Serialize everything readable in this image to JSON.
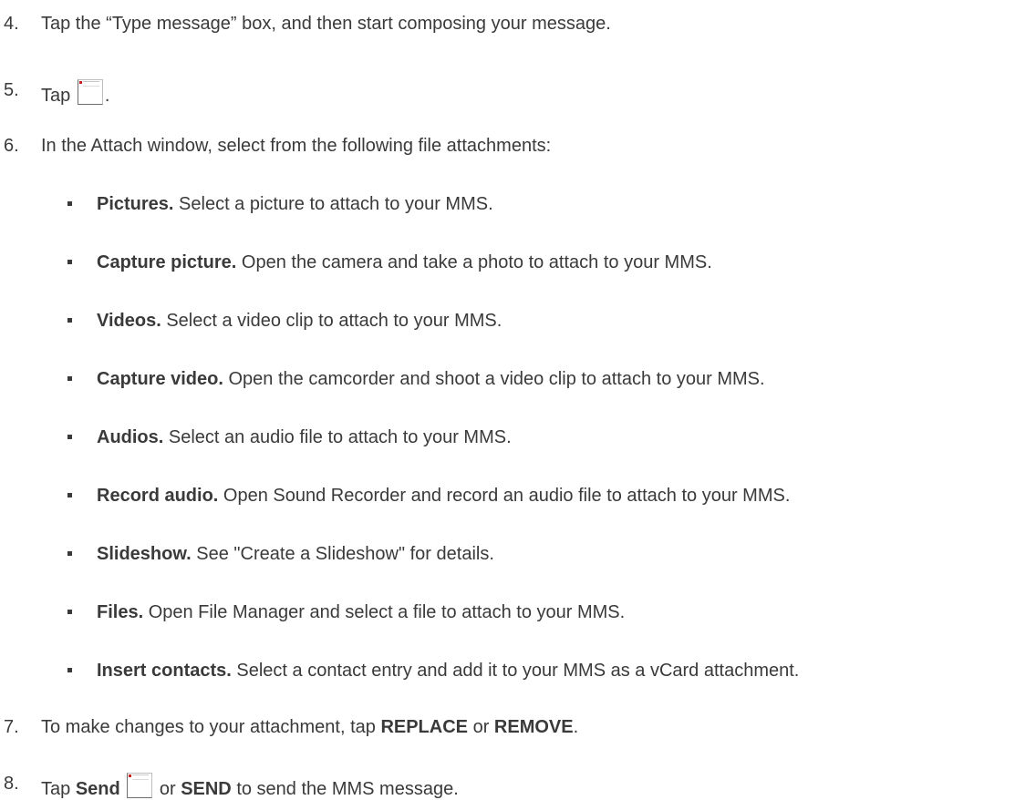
{
  "steps": {
    "s4": {
      "num": "4.",
      "text": "Tap the “Type message” box, and then start composing your message."
    },
    "s5": {
      "num": "5.",
      "pre": "Tap",
      "icon": "attach-icon",
      "post": "."
    },
    "s6": {
      "num": "6.",
      "text": "In the Attach window, select from the following file attachments:"
    },
    "s7": {
      "num": "7.",
      "pre": "To make changes to your attachment, tap ",
      "b1": "REPLACE",
      "mid": " or ",
      "b2": "REMOVE",
      "post": "."
    },
    "s8": {
      "num": "8.",
      "pre": "Tap ",
      "b1": "Send",
      "icon": "send-icon",
      "mid": " or ",
      "b2": "SEND",
      "post": " to send the MMS message."
    }
  },
  "attachments": [
    {
      "label": "Pictures.",
      "desc": " Select a picture to attach to your MMS."
    },
    {
      "label": "Capture picture.",
      "desc": " Open the camera and take a photo to attach to your MMS."
    },
    {
      "label": "Videos.",
      "desc": " Select a video clip to attach to your MMS."
    },
    {
      "label": "Capture video.",
      "desc": " Open the camcorder and shoot a video clip to attach to your MMS."
    },
    {
      "label": "Audios.",
      "desc": " Select an audio file to attach to your MMS."
    },
    {
      "label": "Record audio.",
      "desc": " Open Sound Recorder and record an audio file to attach to your MMS."
    },
    {
      "label": "Slideshow.",
      "desc": " See \"Create a Slideshow\" for details."
    },
    {
      "label": "Files.",
      "desc": " Open File Manager and select a file to attach to your MMS."
    },
    {
      "label": "Insert contacts.",
      "desc": " Select a contact entry and add it to your MMS as a vCard attachment."
    }
  ]
}
